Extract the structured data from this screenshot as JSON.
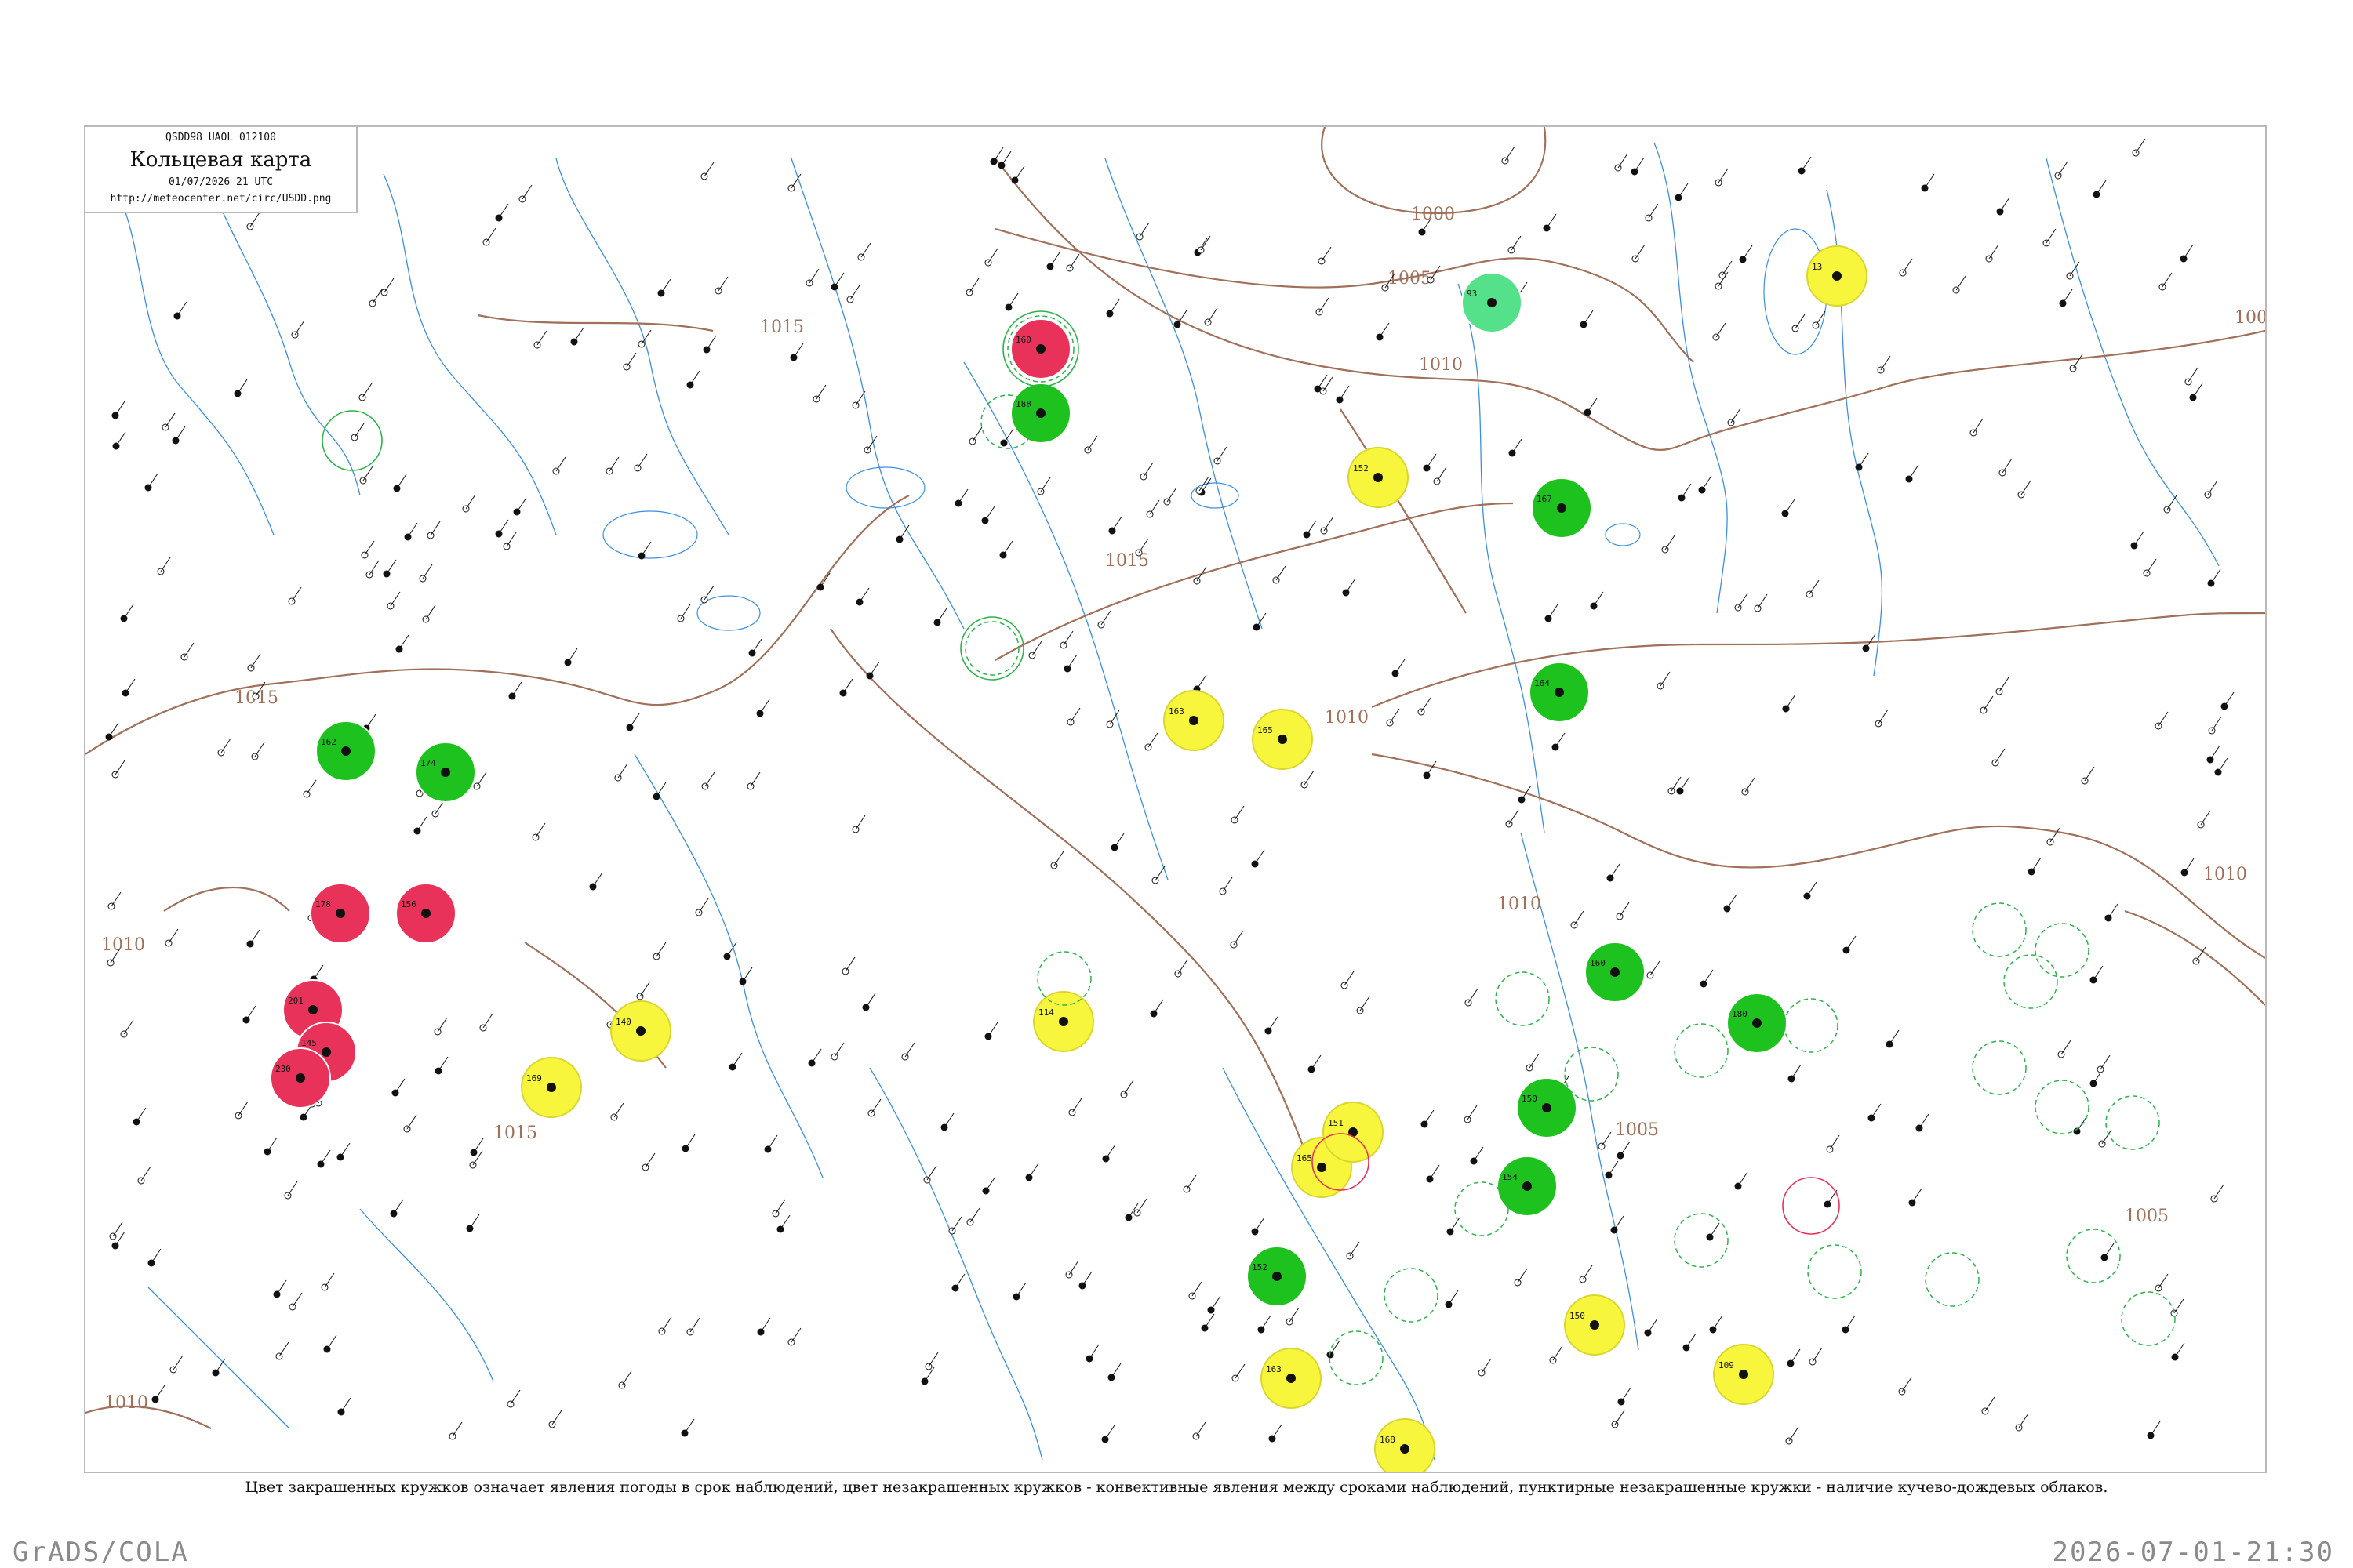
{
  "header": {
    "code": "QSDD98  UAOL  012100",
    "title": "Кольцевая карта",
    "date": "01/07/2026 21 UTC",
    "url": "http://meteocenter.net/circ/USDD.png"
  },
  "isobars": [
    "1000",
    "1005",
    "1010",
    "1015",
    "1015",
    "1015",
    "1010",
    "1010",
    "1005",
    "1005",
    "1010",
    "1005",
    "1010",
    "1010",
    "1015"
  ],
  "caption": "Цвет закрашенных кружков означает явления погоды в срок наблюдений, цвет незакрашенных кружков - конвективные явления между сроками наблюдений, пунктирные незакрашенные кружки - наличие кучево-дождевых облаков.",
  "footer": {
    "software": "GrADS/COLA",
    "timestamp": "2026-07-01-21:30"
  },
  "colors": {
    "red": "#e8325a",
    "green": "#1ec21e",
    "yellow": "#f7f53c",
    "light_green": "#55e08a",
    "isobar": "#a0705a",
    "river": "#3b8fe0",
    "frame": "#b9b9b9"
  },
  "stations": [
    {
      "label": "160",
      "kind": "red"
    },
    {
      "label": "188",
      "kind": "green"
    },
    {
      "label": "152",
      "kind": "yellow"
    },
    {
      "label": "13",
      "kind": "yellow"
    },
    {
      "label": "93",
      "kind": "light_green"
    },
    {
      "label": "163",
      "kind": "yellow"
    },
    {
      "label": "165",
      "kind": "yellow"
    },
    {
      "label": "164",
      "kind": "green"
    },
    {
      "label": "162",
      "kind": "green"
    },
    {
      "label": "178",
      "kind": "red"
    },
    {
      "label": "156",
      "kind": "red"
    },
    {
      "label": "201",
      "kind": "red"
    },
    {
      "label": "145",
      "kind": "red"
    },
    {
      "label": "230",
      "kind": "red"
    },
    {
      "label": "114",
      "kind": "yellow"
    },
    {
      "label": "140",
      "kind": "yellow"
    },
    {
      "label": "169",
      "kind": "yellow"
    },
    {
      "label": "167",
      "kind": "green"
    },
    {
      "label": "160",
      "kind": "green"
    },
    {
      "label": "150",
      "kind": "green"
    },
    {
      "label": "154",
      "kind": "green"
    },
    {
      "label": "152",
      "kind": "green"
    },
    {
      "label": "163",
      "kind": "yellow"
    },
    {
      "label": "165",
      "kind": "yellow"
    },
    {
      "label": "151",
      "kind": "yellow"
    },
    {
      "label": "150",
      "kind": "yellow"
    },
    {
      "label": "109",
      "kind": "yellow"
    },
    {
      "label": "168",
      "kind": "yellow"
    },
    {
      "label": "180",
      "kind": "green"
    },
    {
      "label": "174",
      "kind": "green"
    }
  ]
}
